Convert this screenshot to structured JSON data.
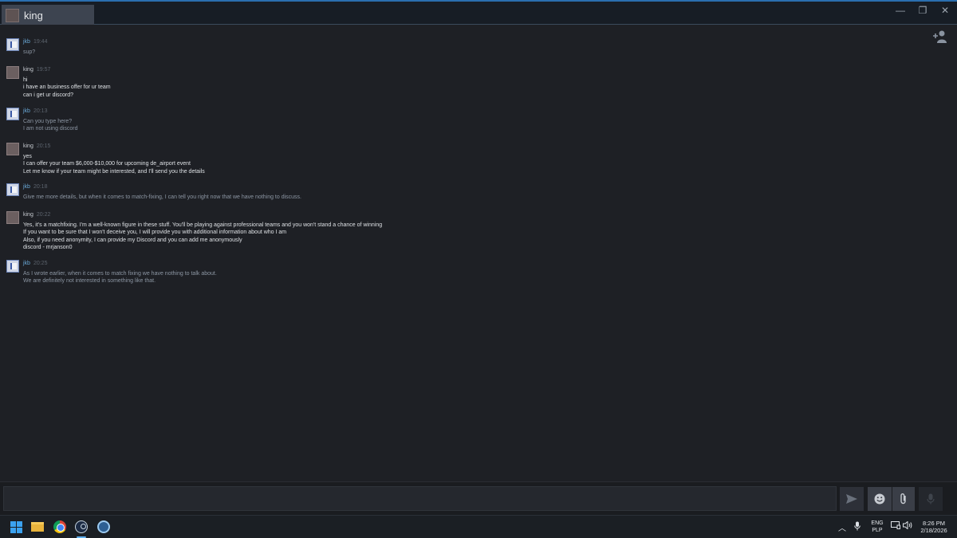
{
  "window": {
    "tab_title": "king",
    "controls": {
      "minimize": "—",
      "restore": "❐",
      "close": "✕"
    }
  },
  "messages": [
    {
      "author": "jkb",
      "time": "19:44",
      "lines": [
        "sup?"
      ]
    },
    {
      "author": "king",
      "time": "19:57",
      "lines": [
        "hi",
        "i have an business offer for ur team",
        "can i get ur discord?"
      ]
    },
    {
      "author": "jkb",
      "time": "20:13",
      "lines": [
        "Can you type here?",
        "I am not using discord"
      ]
    },
    {
      "author": "king",
      "time": "20:15",
      "lines": [
        "yes",
        "I can offer your team $6,000-$10,000 for upcoming de_airport event",
        "Let me know if your team might be interested, and I'll send you the details"
      ]
    },
    {
      "author": "jkb",
      "time": "20:18",
      "lines": [
        "Give me more details, but when it comes to match-fixing, I can tell you right now that we have nothing to discuss."
      ]
    },
    {
      "author": "king",
      "time": "20:22",
      "lines": [
        "Yes, it's a matchfixing. I'm a well-known figure in these stuff. You'll be playing against professional teams and you won't stand a chance of winning",
        "If you want to be sure that I won't deceive you, I will provide you with additional information about who I am",
        "Also, if you need anonymity, I can provide my Discord and you can add me anonymously",
        "discord - mrjanson0"
      ]
    },
    {
      "author": "jkb",
      "time": "20:25",
      "lines": [
        "As I wrote earlier, when it comes to match fixing we have nothing to talk about.",
        "We are definitely not interested in something like that."
      ]
    }
  ],
  "composer": {
    "input_value": "",
    "send_icon": "send-arrow",
    "emoji_icon": "emoji-face",
    "attach_icon": "paperclip",
    "voice_icon": "microphone"
  },
  "taskbar": {
    "language_primary": "ENG",
    "language_secondary": "PLP",
    "time": "8:26 PM",
    "date": "2/18/2026",
    "accent_color": "#5fb0f0"
  },
  "colors": {
    "jkb_name": "#6aa8d6",
    "king_name": "#c7cbd1",
    "title_accent": "#2a6fb0"
  }
}
